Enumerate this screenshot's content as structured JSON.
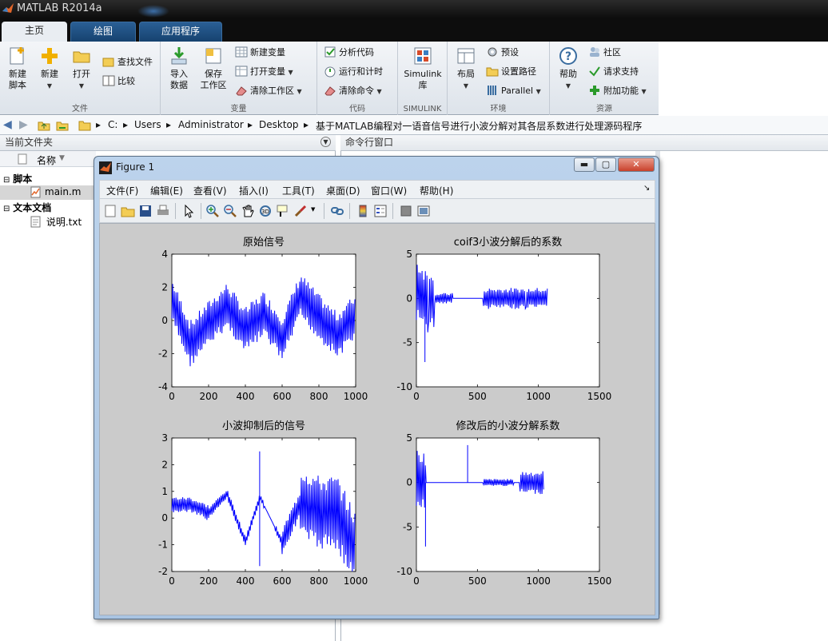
{
  "app": {
    "title": "MATLAB R2014a"
  },
  "tabs": [
    {
      "label": "主页"
    },
    {
      "label": "绘图"
    },
    {
      "label": "应用程序"
    }
  ],
  "ribbon": {
    "file": {
      "group": "文件",
      "new_script": "新建\n脚本",
      "new": "新建",
      "open": "打开",
      "find_files": "查找文件",
      "compare": "比较"
    },
    "variable": {
      "group": "变量",
      "import": "导入\n数据",
      "save_ws": "保存\n工作区",
      "new_var": "新建变量",
      "open_var": "打开变量",
      "clear_ws": "清除工作区"
    },
    "code": {
      "group": "代码",
      "analyze": "分析代码",
      "run_time": "运行和计时",
      "clear_cmd": "清除命令"
    },
    "simulink": {
      "group": "SIMULINK",
      "lib": "Simulink\n库"
    },
    "env": {
      "group": "环境",
      "layout": "布局",
      "prefs": "预设",
      "set_path": "设置路径",
      "parallel": "Parallel"
    },
    "resources": {
      "group": "资源",
      "help": "帮助",
      "community": "社区",
      "support": "请求支持",
      "addons": "附加功能"
    }
  },
  "address": {
    "crumbs": [
      "C:",
      "Users",
      "Administrator",
      "Desktop",
      "基于MATLAB编程对一语音信号进行小波分解对其各层系数进行处理源码程序"
    ]
  },
  "left_panel": {
    "title": "当前文件夹",
    "col_name": "名称",
    "groups": [
      {
        "label": "脚本",
        "items": [
          "main.m"
        ]
      },
      {
        "label": "文本文档",
        "items": [
          "说明.txt"
        ]
      }
    ]
  },
  "command": {
    "title": "命令行窗口"
  },
  "figure": {
    "title": "Figure 1",
    "menu": [
      "文件(F)",
      "编辑(E)",
      "查看(V)",
      "插入(I)",
      "工具(T)",
      "桌面(D)",
      "窗口(W)",
      "帮助(H)"
    ],
    "tools": [
      "new-figure-icon",
      "open-icon",
      "save-icon",
      "print-icon",
      "pointer-icon",
      "zoom-in-icon",
      "zoom-out-icon",
      "pan-icon",
      "rotate-icon",
      "data-cursor-icon",
      "brush-icon",
      "link-icon",
      "colorbar-icon",
      "legend-icon",
      "hide-plot-tools-icon",
      "show-plot-tools-icon"
    ]
  },
  "chart_data": [
    {
      "type": "line",
      "title": "原始信号",
      "xlim": [
        0,
        1000
      ],
      "ylim": [
        -4,
        4
      ],
      "xticks": [
        0,
        200,
        400,
        600,
        800,
        1000
      ],
      "yticks": [
        4,
        2,
        0,
        -2,
        -4
      ],
      "x": [
        0,
        100,
        200,
        300,
        400,
        500,
        600,
        700,
        800,
        900,
        1000
      ],
      "series": [
        {
          "values": [
            1.2,
            -1.4,
            -0.2,
            0.9,
            -0.6,
            0.4,
            -1.1,
            1.5,
            0.2,
            -0.9,
            0.3
          ],
          "color": "#0000ff"
        }
      ]
    },
    {
      "type": "line",
      "title": "coif3小波分解后的系数",
      "xlim": [
        0,
        1500
      ],
      "ylim": [
        -10,
        5
      ],
      "xticks": [
        0,
        500,
        1000,
        1500
      ],
      "yticks": [
        5,
        0,
        -5,
        -10
      ],
      "x": [
        0,
        100,
        150,
        300,
        550,
        700,
        900,
        1080
      ],
      "series": [
        {
          "values": [
            1.0,
            -0.5,
            0,
            0,
            0,
            0,
            0,
            0
          ],
          "color": "#0000ff"
        }
      ]
    },
    {
      "type": "line",
      "title": "小波抑制后的信号",
      "xlim": [
        0,
        1000
      ],
      "ylim": [
        -2,
        3
      ],
      "xticks": [
        0,
        200,
        400,
        600,
        800,
        1000
      ],
      "yticks": [
        3,
        2,
        1,
        0,
        -1,
        -2
      ],
      "x": [
        0,
        100,
        200,
        300,
        400,
        480,
        500,
        600,
        700,
        800,
        900,
        1000
      ],
      "series": [
        {
          "values": [
            0.5,
            0.5,
            0.2,
            0.9,
            -0.9,
            0.8,
            0.5,
            -0.9,
            0.6,
            0.2,
            0.2,
            -1.2
          ],
          "color": "#0000ff"
        }
      ]
    },
    {
      "type": "line",
      "title": "修改后的小波分解系数",
      "xlim": [
        0,
        1500
      ],
      "ylim": [
        -10,
        5
      ],
      "xticks": [
        0,
        500,
        1000,
        1500
      ],
      "yticks": [
        5,
        0,
        -5,
        -10
      ],
      "x": [
        0,
        80,
        300,
        420,
        550,
        780,
        850,
        1050
      ],
      "series": [
        {
          "values": [
            0.5,
            0,
            0,
            0,
            0,
            0,
            0,
            0
          ],
          "color": "#0000ff"
        }
      ]
    }
  ]
}
